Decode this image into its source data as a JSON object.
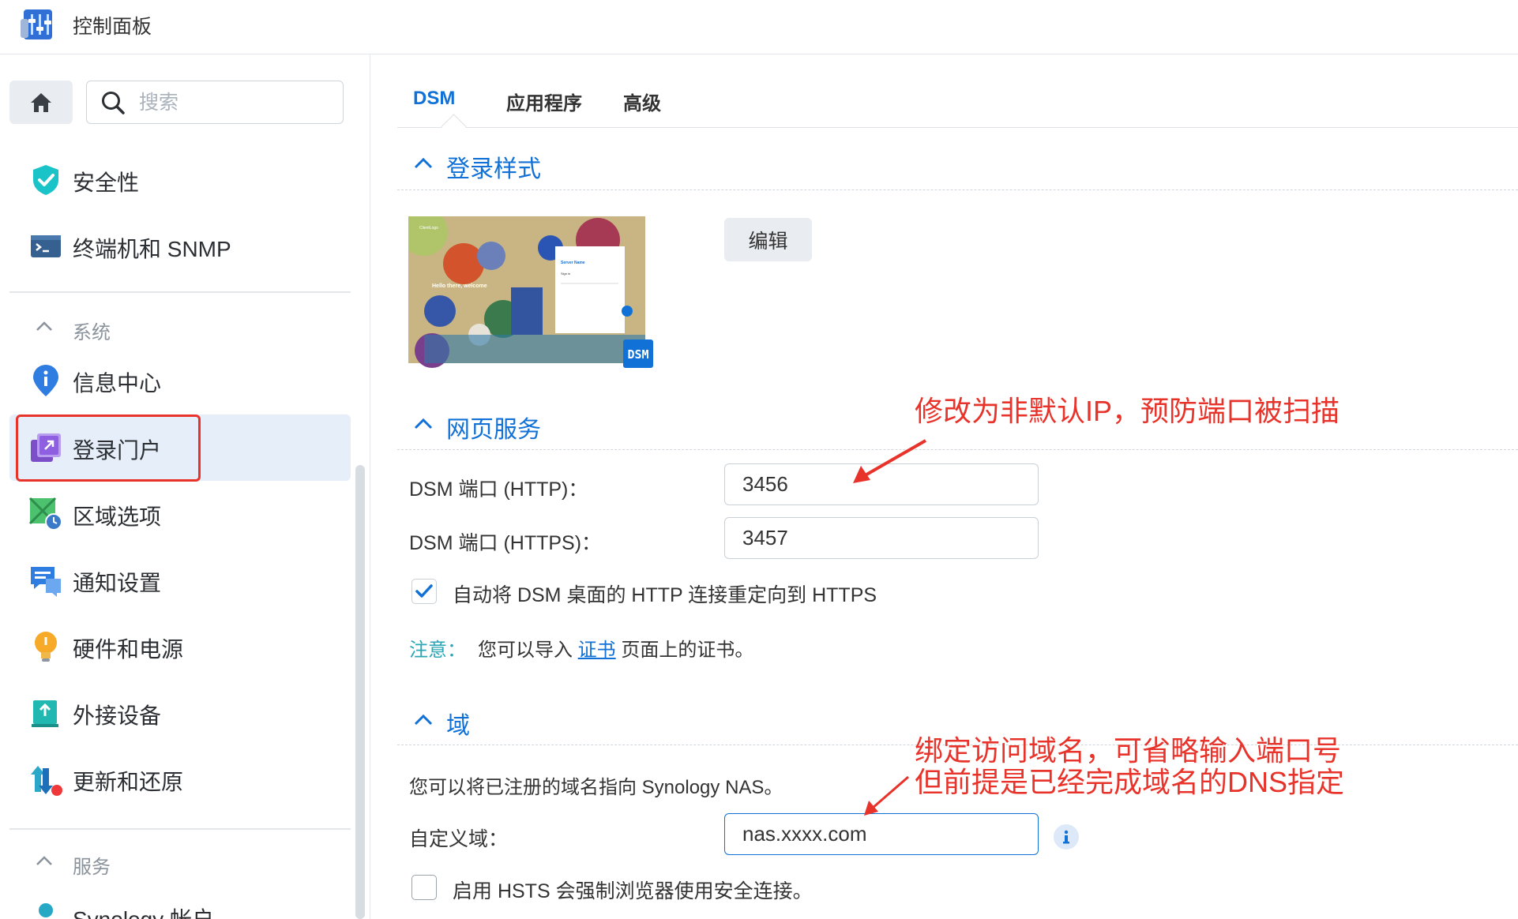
{
  "window": {
    "title": "控制面板"
  },
  "sidebar": {
    "search_placeholder": "搜索",
    "items_top": [
      {
        "label": "安全性",
        "icon": "shield-check-icon"
      },
      {
        "label": "终端机和 SNMP",
        "icon": "terminal-icon"
      }
    ],
    "group_system": {
      "label": "系统"
    },
    "items_system": [
      {
        "label": "信息中心",
        "icon": "info-pin-icon"
      },
      {
        "label": "登录门户",
        "icon": "login-portal-icon",
        "active": true
      },
      {
        "label": "区域选项",
        "icon": "region-clock-icon"
      },
      {
        "label": "通知设置",
        "icon": "notification-icon"
      },
      {
        "label": "硬件和电源",
        "icon": "bulb-icon"
      },
      {
        "label": "外接设备",
        "icon": "external-device-icon"
      },
      {
        "label": "更新和还原",
        "icon": "update-restore-icon"
      }
    ],
    "group_services": {
      "label": "服务"
    },
    "items_services": [
      {
        "label": "Synology 帐户",
        "icon": "user-icon"
      }
    ]
  },
  "tabs": [
    {
      "label": "DSM",
      "active": true
    },
    {
      "label": "应用程序",
      "active": false
    },
    {
      "label": "高级",
      "active": false
    }
  ],
  "login_style": {
    "title": "登录样式",
    "edit_button": "编辑",
    "preview": {
      "logo_text": "ClientLogo",
      "welcome": "Hello there, welcome",
      "server_name": "Server Name",
      "sign_in": "Sign in",
      "badge": "DSM"
    }
  },
  "web_service": {
    "title": "网页服务",
    "http_label": "DSM 端口 (HTTP)：",
    "http_value": "3456",
    "https_label": "DSM 端口 (HTTPS)：",
    "https_value": "3457",
    "redirect_checkbox": {
      "label": "自动将 DSM 桌面的 HTTP 连接重定向到 HTTPS",
      "checked": true
    },
    "note": {
      "label": "注意：",
      "before": "您可以导入",
      "link": "证书",
      "after": "页面上的证书。"
    }
  },
  "domain": {
    "title": "域",
    "description": "您可以将已注册的域名指向 Synology NAS。",
    "custom_label": "自定义域：",
    "custom_value": "nas.xxxx.com",
    "hsts_checkbox": {
      "label": "启用 HSTS 会强制浏览器使用安全连接。",
      "checked": false
    }
  },
  "annotations": {
    "port_note": "修改为非默认IP，预防端口被扫描",
    "domain_note_line1": "绑定访问域名，可省略输入端口号",
    "domain_note_line2": "但前提是已经完成域名的DNS指定"
  },
  "colors": {
    "accent": "#1171d6",
    "annotation_red": "#e8332b",
    "note_teal": "#2aa5b5",
    "active_bg": "#e6eefa"
  }
}
